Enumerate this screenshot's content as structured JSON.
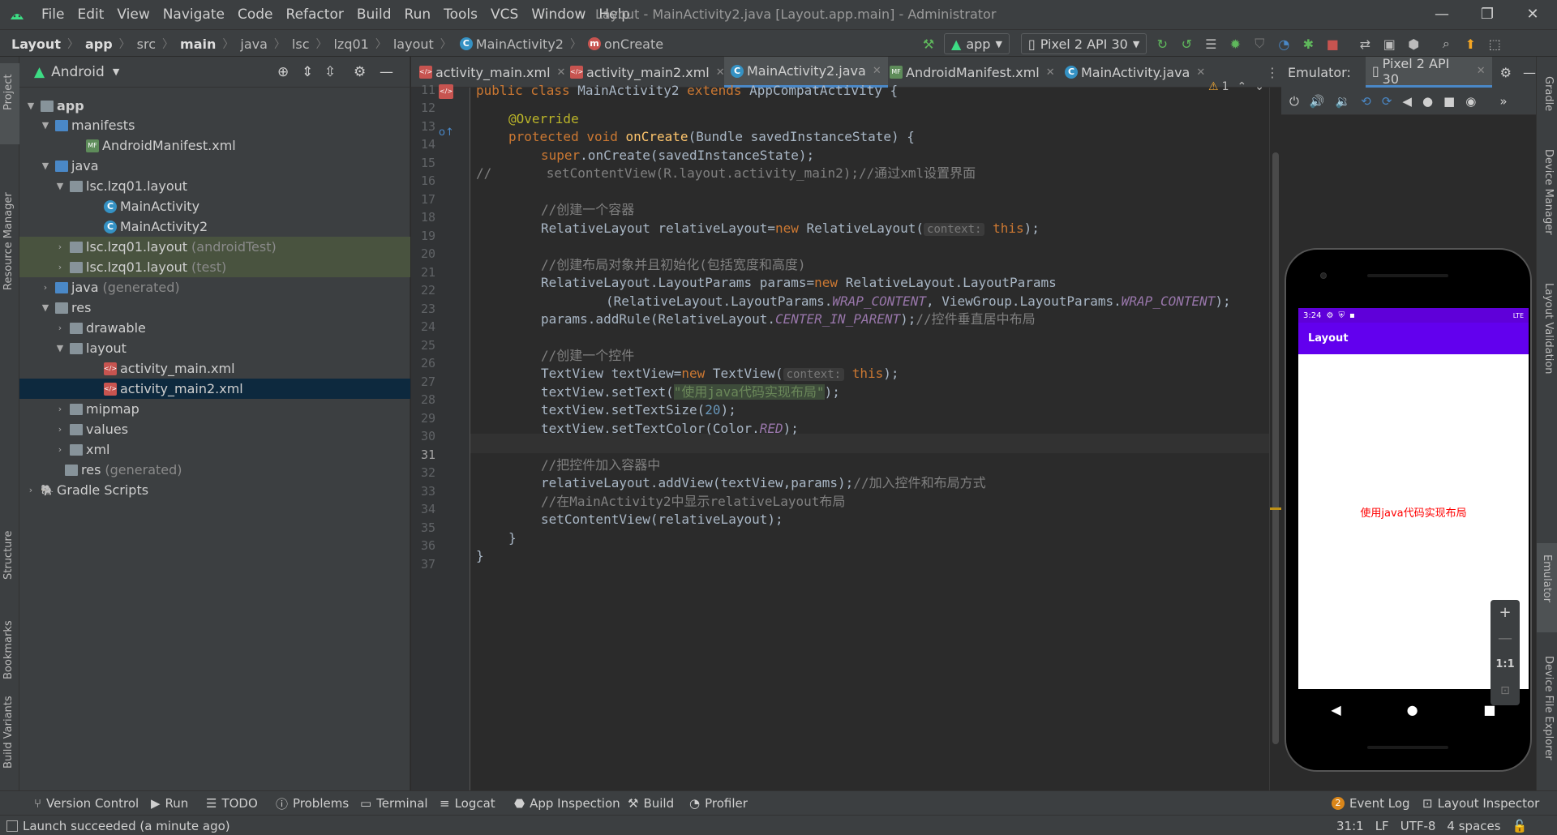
{
  "menu": [
    "File",
    "Edit",
    "View",
    "Navigate",
    "Code",
    "Refactor",
    "Build",
    "Run",
    "Tools",
    "VCS",
    "Window",
    "Help"
  ],
  "window_title": "Layout - MainActivity2.java [Layout.app.main] - Administrator",
  "breadcrumbs": [
    "Layout",
    "app",
    "src",
    "main",
    "java",
    "lsc",
    "lzq01",
    "layout",
    "MainActivity2",
    "onCreate"
  ],
  "toolbar": {
    "run_config": "app",
    "device": "Pixel 2 API 30"
  },
  "project": {
    "view_label": "Android",
    "tree": [
      {
        "label": "app",
        "hint": ""
      },
      {
        "label": "manifests",
        "hint": ""
      },
      {
        "label": "AndroidManifest.xml",
        "hint": ""
      },
      {
        "label": "java",
        "hint": ""
      },
      {
        "label": "lsc.lzq01.layout",
        "hint": ""
      },
      {
        "label": "MainActivity",
        "hint": ""
      },
      {
        "label": "MainActivity2",
        "hint": ""
      },
      {
        "label": "lsc.lzq01.layout",
        "hint": "(androidTest)"
      },
      {
        "label": "lsc.lzq01.layout",
        "hint": "(test)"
      },
      {
        "label": "java",
        "hint": "(generated)"
      },
      {
        "label": "res",
        "hint": ""
      },
      {
        "label": "drawable",
        "hint": ""
      },
      {
        "label": "layout",
        "hint": ""
      },
      {
        "label": "activity_main.xml",
        "hint": ""
      },
      {
        "label": "activity_main2.xml",
        "hint": ""
      },
      {
        "label": "mipmap",
        "hint": ""
      },
      {
        "label": "values",
        "hint": ""
      },
      {
        "label": "xml",
        "hint": ""
      },
      {
        "label": "res",
        "hint": "(generated)"
      },
      {
        "label": "Gradle Scripts",
        "hint": ""
      }
    ]
  },
  "left_tabs": [
    "Project",
    "Resource Manager",
    "Structure",
    "Bookmarks",
    "Build Variants"
  ],
  "editor_tabs": [
    "activity_main.xml",
    "activity_main2.xml",
    "MainActivity2.java",
    "AndroidManifest.xml",
    "MainActivity.java"
  ],
  "editor": {
    "warning_count": "1",
    "line_numbers": [
      "11",
      "12",
      "13",
      "14",
      "15",
      "16",
      "17",
      "18",
      "19",
      "20",
      "21",
      "22",
      "23",
      "24",
      "25",
      "26",
      "27",
      "28",
      "29",
      "30",
      "31",
      "32",
      "33",
      "34",
      "35",
      "36",
      "37"
    ],
    "current_line": "31"
  },
  "code": {
    "l11_a": "public class ",
    "l11_b": "MainActivity2 ",
    "l11_c": "extends ",
    "l11_d": "AppCompatActivity {",
    "l13": "@Override",
    "l14_a": "protected void ",
    "l14_b": "onCreate",
    "l14_c": "(Bundle savedInstanceState) {",
    "l15_a": "super",
    "l15_b": ".onCreate(savedInstanceState);",
    "l16": "//       setContentView(R.layout.activity_main2);//通过xml设置界面",
    "l18": "//创建一个容器",
    "l19_a": "RelativeLayout relativeLayout=",
    "l19_b": "new ",
    "l19_c": "RelativeLayout(",
    "l19_hint": "context:",
    "l19_d": " this",
    "l19_e": ");",
    "l21": "//创建布局对象并且初始化(包括宽度和高度)",
    "l22_a": "RelativeLayout.LayoutParams params=",
    "l22_b": "new ",
    "l22_c": "RelativeLayout.LayoutParams",
    "l23_a": "(RelativeLayout.LayoutParams.",
    "l23_b": "WRAP_CONTENT",
    "l23_c": ", ViewGroup.LayoutParams.",
    "l23_d": "WRAP_CONTENT",
    "l23_e": ");",
    "l24_a": "params.addRule(RelativeLayout.",
    "l24_b": "CENTER_IN_PARENT",
    "l24_c": ");",
    "l24_d": "//控件垂直居中布局",
    "l26": "//创建一个控件",
    "l27_a": "TextView textView=",
    "l27_b": "new ",
    "l27_c": "TextView(",
    "l27_hint": "context:",
    "l27_d": " this",
    "l27_e": ");",
    "l28_a": "textView.setText(",
    "l28_b": "\"使用java代码实现布局\"",
    "l28_c": ");",
    "l29_a": "textView.setTextSize(",
    "l29_b": "20",
    "l29_c": ");",
    "l30_a": "textView.setTextColor(Color.",
    "l30_b": "RED",
    "l30_c": ");",
    "l32": "//把控件加入容器中",
    "l33_a": "relativeLayout.addView(textView,params);",
    "l33_b": "//加入控件和布局方式",
    "l34": "//在MainActivity2中显示relativeLayout布局",
    "l35": "setContentView(relativeLayout);",
    "l36": "}",
    "l37": "}"
  },
  "emulator": {
    "label": "Emulator:",
    "device_tab": "Pixel 2 API 30",
    "status_time": "3:24",
    "status_right": "LTE",
    "app_title": "Layout",
    "center_text": "使用java代码实现布局",
    "zoom_ratio": "1:1"
  },
  "right_tabs": [
    "Gradle",
    "Device Manager",
    "Layout Validation",
    "Emulator",
    "Device File Explorer"
  ],
  "bottom_tools": [
    "Version Control",
    "Run",
    "TODO",
    "Problems",
    "Terminal",
    "Logcat",
    "App Inspection",
    "Build",
    "Profiler"
  ],
  "bottom_right": {
    "event_log_count": "2",
    "event_log": "Event Log",
    "layout_inspector": "Layout Inspector"
  },
  "status": {
    "message": "Launch succeeded (a minute ago)",
    "position": "31:1",
    "line_sep": "LF",
    "encoding": "UTF-8",
    "indent": "4 spaces"
  },
  "colors": {
    "accent": "#4a88c7",
    "app_bar": "#6200ee",
    "status_bar": "#5f00d9",
    "text_red": "#ff0000"
  }
}
